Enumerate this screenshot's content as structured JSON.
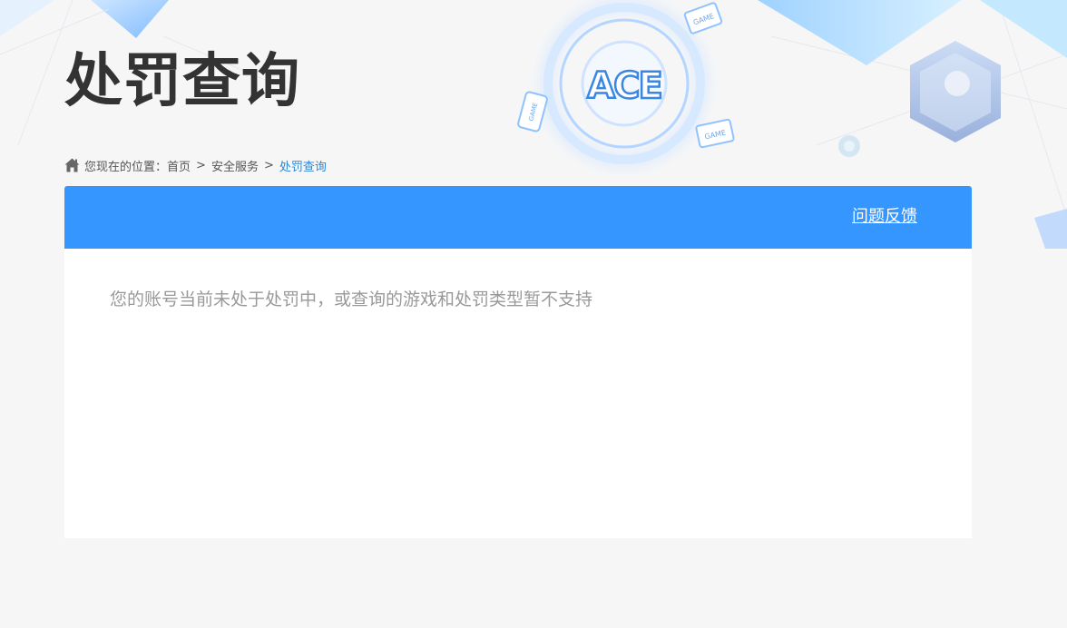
{
  "page": {
    "title": "处罚查询"
  },
  "breadcrumb": {
    "prefix": "您现在的位置：",
    "items": [
      "首页",
      "安全服务",
      "处罚查询"
    ],
    "separator": ">"
  },
  "header": {
    "feedback_label": "问题反馈"
  },
  "result": {
    "message": "您的账号当前未处于处罚中，或查询的游戏和处罚类型暂不支持"
  },
  "logo": {
    "text": "ACE",
    "badges": [
      "GAME",
      "GAME",
      "GAME"
    ]
  },
  "icons": {
    "home": "home-icon"
  },
  "colors": {
    "accent": "#3596ff",
    "link_current": "#2a87d8",
    "title": "#333333",
    "message": "#999999",
    "background": "#f6f6f6"
  }
}
